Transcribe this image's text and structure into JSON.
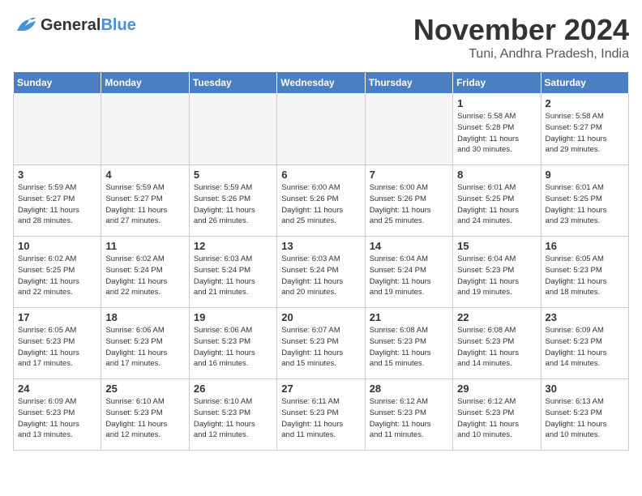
{
  "header": {
    "logo_general": "General",
    "logo_blue": "Blue",
    "month": "November 2024",
    "location": "Tuni, Andhra Pradesh, India"
  },
  "weekdays": [
    "Sunday",
    "Monday",
    "Tuesday",
    "Wednesday",
    "Thursday",
    "Friday",
    "Saturday"
  ],
  "weeks": [
    [
      {
        "day": "",
        "info": "",
        "empty": true
      },
      {
        "day": "",
        "info": "",
        "empty": true
      },
      {
        "day": "",
        "info": "",
        "empty": true
      },
      {
        "day": "",
        "info": "",
        "empty": true
      },
      {
        "day": "",
        "info": "",
        "empty": true
      },
      {
        "day": "1",
        "info": "Sunrise: 5:58 AM\nSunset: 5:28 PM\nDaylight: 11 hours\nand 30 minutes."
      },
      {
        "day": "2",
        "info": "Sunrise: 5:58 AM\nSunset: 5:27 PM\nDaylight: 11 hours\nand 29 minutes."
      }
    ],
    [
      {
        "day": "3",
        "info": "Sunrise: 5:59 AM\nSunset: 5:27 PM\nDaylight: 11 hours\nand 28 minutes."
      },
      {
        "day": "4",
        "info": "Sunrise: 5:59 AM\nSunset: 5:27 PM\nDaylight: 11 hours\nand 27 minutes."
      },
      {
        "day": "5",
        "info": "Sunrise: 5:59 AM\nSunset: 5:26 PM\nDaylight: 11 hours\nand 26 minutes."
      },
      {
        "day": "6",
        "info": "Sunrise: 6:00 AM\nSunset: 5:26 PM\nDaylight: 11 hours\nand 25 minutes."
      },
      {
        "day": "7",
        "info": "Sunrise: 6:00 AM\nSunset: 5:26 PM\nDaylight: 11 hours\nand 25 minutes."
      },
      {
        "day": "8",
        "info": "Sunrise: 6:01 AM\nSunset: 5:25 PM\nDaylight: 11 hours\nand 24 minutes."
      },
      {
        "day": "9",
        "info": "Sunrise: 6:01 AM\nSunset: 5:25 PM\nDaylight: 11 hours\nand 23 minutes."
      }
    ],
    [
      {
        "day": "10",
        "info": "Sunrise: 6:02 AM\nSunset: 5:25 PM\nDaylight: 11 hours\nand 22 minutes."
      },
      {
        "day": "11",
        "info": "Sunrise: 6:02 AM\nSunset: 5:24 PM\nDaylight: 11 hours\nand 22 minutes."
      },
      {
        "day": "12",
        "info": "Sunrise: 6:03 AM\nSunset: 5:24 PM\nDaylight: 11 hours\nand 21 minutes."
      },
      {
        "day": "13",
        "info": "Sunrise: 6:03 AM\nSunset: 5:24 PM\nDaylight: 11 hours\nand 20 minutes."
      },
      {
        "day": "14",
        "info": "Sunrise: 6:04 AM\nSunset: 5:24 PM\nDaylight: 11 hours\nand 19 minutes."
      },
      {
        "day": "15",
        "info": "Sunrise: 6:04 AM\nSunset: 5:23 PM\nDaylight: 11 hours\nand 19 minutes."
      },
      {
        "day": "16",
        "info": "Sunrise: 6:05 AM\nSunset: 5:23 PM\nDaylight: 11 hours\nand 18 minutes."
      }
    ],
    [
      {
        "day": "17",
        "info": "Sunrise: 6:05 AM\nSunset: 5:23 PM\nDaylight: 11 hours\nand 17 minutes."
      },
      {
        "day": "18",
        "info": "Sunrise: 6:06 AM\nSunset: 5:23 PM\nDaylight: 11 hours\nand 17 minutes."
      },
      {
        "day": "19",
        "info": "Sunrise: 6:06 AM\nSunset: 5:23 PM\nDaylight: 11 hours\nand 16 minutes."
      },
      {
        "day": "20",
        "info": "Sunrise: 6:07 AM\nSunset: 5:23 PM\nDaylight: 11 hours\nand 15 minutes."
      },
      {
        "day": "21",
        "info": "Sunrise: 6:08 AM\nSunset: 5:23 PM\nDaylight: 11 hours\nand 15 minutes."
      },
      {
        "day": "22",
        "info": "Sunrise: 6:08 AM\nSunset: 5:23 PM\nDaylight: 11 hours\nand 14 minutes."
      },
      {
        "day": "23",
        "info": "Sunrise: 6:09 AM\nSunset: 5:23 PM\nDaylight: 11 hours\nand 14 minutes."
      }
    ],
    [
      {
        "day": "24",
        "info": "Sunrise: 6:09 AM\nSunset: 5:23 PM\nDaylight: 11 hours\nand 13 minutes."
      },
      {
        "day": "25",
        "info": "Sunrise: 6:10 AM\nSunset: 5:23 PM\nDaylight: 11 hours\nand 12 minutes."
      },
      {
        "day": "26",
        "info": "Sunrise: 6:10 AM\nSunset: 5:23 PM\nDaylight: 11 hours\nand 12 minutes."
      },
      {
        "day": "27",
        "info": "Sunrise: 6:11 AM\nSunset: 5:23 PM\nDaylight: 11 hours\nand 11 minutes."
      },
      {
        "day": "28",
        "info": "Sunrise: 6:12 AM\nSunset: 5:23 PM\nDaylight: 11 hours\nand 11 minutes."
      },
      {
        "day": "29",
        "info": "Sunrise: 6:12 AM\nSunset: 5:23 PM\nDaylight: 11 hours\nand 10 minutes."
      },
      {
        "day": "30",
        "info": "Sunrise: 6:13 AM\nSunset: 5:23 PM\nDaylight: 11 hours\nand 10 minutes."
      }
    ]
  ]
}
